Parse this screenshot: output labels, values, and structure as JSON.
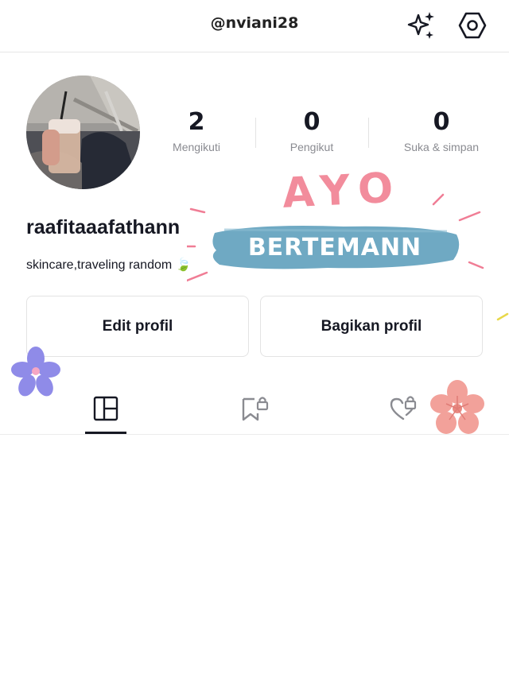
{
  "header": {
    "handle": "@nviani28",
    "icons": [
      "sparkle-icon",
      "settings-hexagon-icon"
    ]
  },
  "profile": {
    "username": "raafitaaafathann",
    "bio": "skincare,traveling random 🍃"
  },
  "stats": [
    {
      "value": "2",
      "label": "Mengikuti"
    },
    {
      "value": "0",
      "label": "Pengikut"
    },
    {
      "value": "0",
      "label": "Suka & simpan"
    }
  ],
  "buttons": {
    "edit": "Edit profil",
    "share": "Bagikan profil"
  },
  "tabs": [
    {
      "icon": "grid-icon",
      "active": true
    },
    {
      "icon": "bookmark-lock-icon",
      "active": false
    },
    {
      "icon": "heart-lock-icon",
      "active": false
    }
  ],
  "stickers": {
    "top": "AYO",
    "banner": "BERTEMANN"
  },
  "colors": {
    "banner": "#6fa9c3",
    "ayo": "#f28c9c",
    "flower_purple": "#8f8be8",
    "flower_pink": "#f2a19a"
  }
}
